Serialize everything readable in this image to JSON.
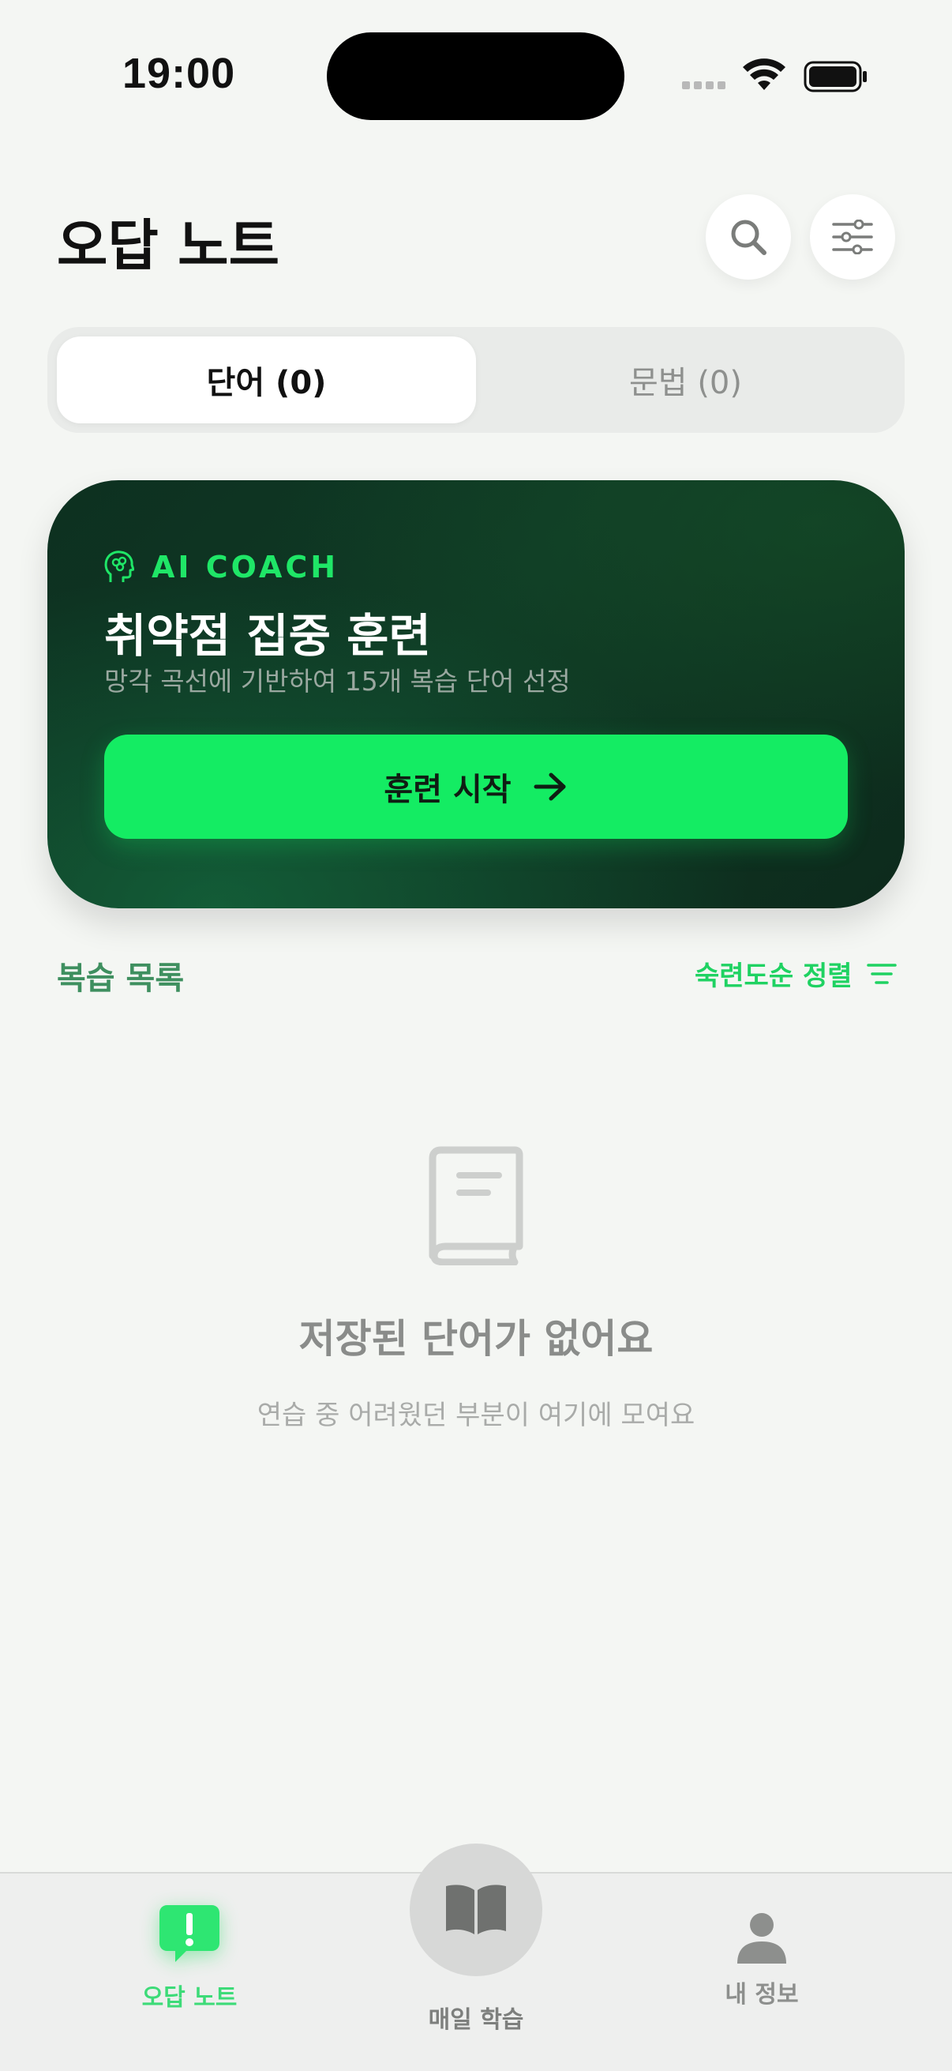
{
  "status_bar": {
    "time": "19:00"
  },
  "header": {
    "title": "오답 노트"
  },
  "segments": [
    {
      "label": "단어 (0)",
      "active": true
    },
    {
      "label": "문법 (0)",
      "active": false
    }
  ],
  "coach": {
    "badge": "AI COACH",
    "title": "취약점 집중 훈련",
    "subtitle": "망각 곡선에 기반하여 15개 복습 단어 선정",
    "button_label": "훈련 시작"
  },
  "review_list": {
    "title": "복습 목록",
    "sort_label": "숙련도순 정렬"
  },
  "empty_state": {
    "title": "저장된 단어가 없어요",
    "subtitle": "연습 중 어려웠던 부분이 여기에 모여요"
  },
  "tabbar": {
    "items": [
      {
        "label": "오답 노트",
        "icon": "chat-exclamation-icon",
        "active": true
      },
      {
        "label": "매일 학습",
        "icon": "open-book-icon",
        "active": false
      },
      {
        "label": "내 정보",
        "icon": "person-icon",
        "active": false
      }
    ]
  },
  "colors": {
    "accent": "#14ec63",
    "card_dark": "#0f3a25",
    "list_title": "#3e8f5f"
  }
}
